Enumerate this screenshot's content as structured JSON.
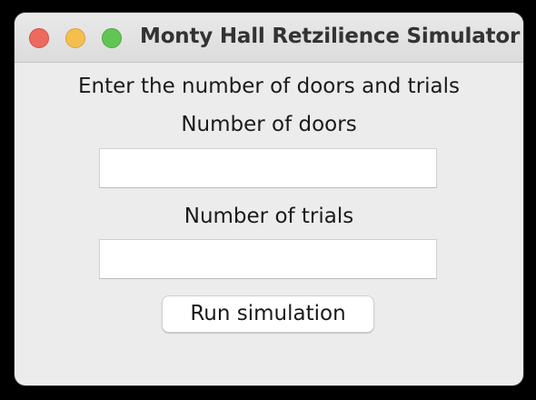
{
  "window": {
    "title": "Monty Hall Retzilience Simulator",
    "controls": [
      "close-button",
      "minimize-button",
      "zoom-button"
    ]
  },
  "form": {
    "prompt": "Enter the number of doors and trials",
    "doors_label": "Number of doors",
    "doors_value": "",
    "trials_label": "Number of trials",
    "trials_value": "",
    "run_label": "Run simulation"
  },
  "colors": {
    "close": "#ed6a5e",
    "minimize": "#f5bf4f",
    "zoom": "#61c554",
    "window_bg": "#ececec"
  }
}
